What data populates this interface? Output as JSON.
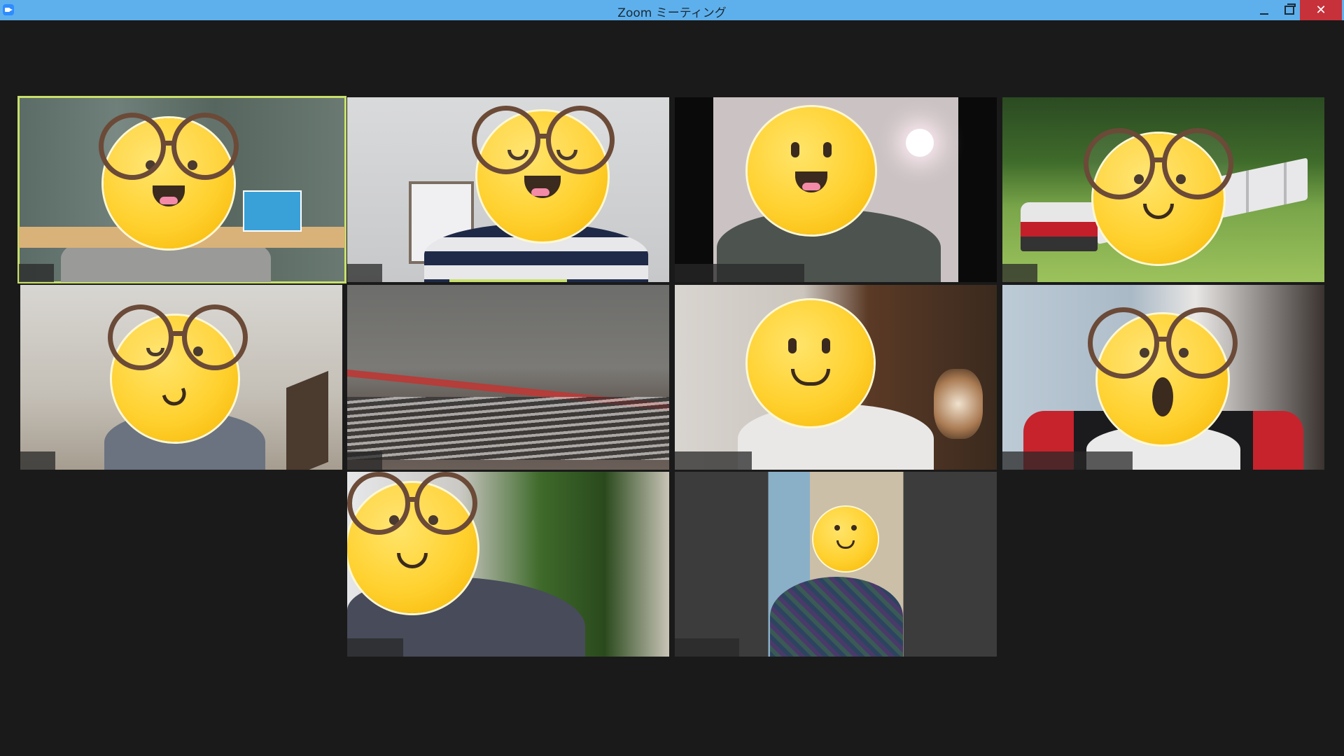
{
  "window": {
    "title": "Zoom ミーティング",
    "controls": {
      "minimize": "minimize",
      "maximize": "maximize",
      "close": "✕"
    }
  },
  "colors": {
    "titlebar": "#5eb0ec",
    "background": "#1a1a1a",
    "active_speaker": "#c8e06a",
    "close_button": "#c7313a"
  },
  "participants": [
    {
      "id": 1,
      "name": "",
      "scene": "curtain",
      "emoji": "smile-open",
      "glasses": true,
      "active": true
    },
    {
      "id": 2,
      "name": "",
      "scene": "wall",
      "emoji": "laugh",
      "glasses": true,
      "active": false,
      "speaking_level": 0.36
    },
    {
      "id": 3,
      "name": "",
      "scene": "dark-room",
      "emoji": "grin",
      "glasses": false,
      "active": false
    },
    {
      "id": 4,
      "name": "",
      "scene": "railway",
      "emoji": "smile",
      "glasses": true,
      "active": false
    },
    {
      "id": 5,
      "name": "",
      "scene": "room",
      "emoji": "wink",
      "glasses": true,
      "active": false
    },
    {
      "id": 6,
      "name": "",
      "scene": "train-layout",
      "emoji": "none",
      "glasses": false,
      "active": false
    },
    {
      "id": 7,
      "name": "",
      "scene": "cabinet",
      "emoji": "smile",
      "glasses": false,
      "active": false
    },
    {
      "id": 8,
      "name": "",
      "scene": "gaming-chair",
      "emoji": "surprised",
      "glasses": true,
      "active": false
    },
    {
      "id": 9,
      "name": "",
      "scene": "church",
      "emoji": "smile",
      "glasses": true,
      "active": false
    },
    {
      "id": 10,
      "name": "",
      "scene": "portrait",
      "emoji": "smile-small",
      "glasses": false,
      "active": false
    }
  ]
}
